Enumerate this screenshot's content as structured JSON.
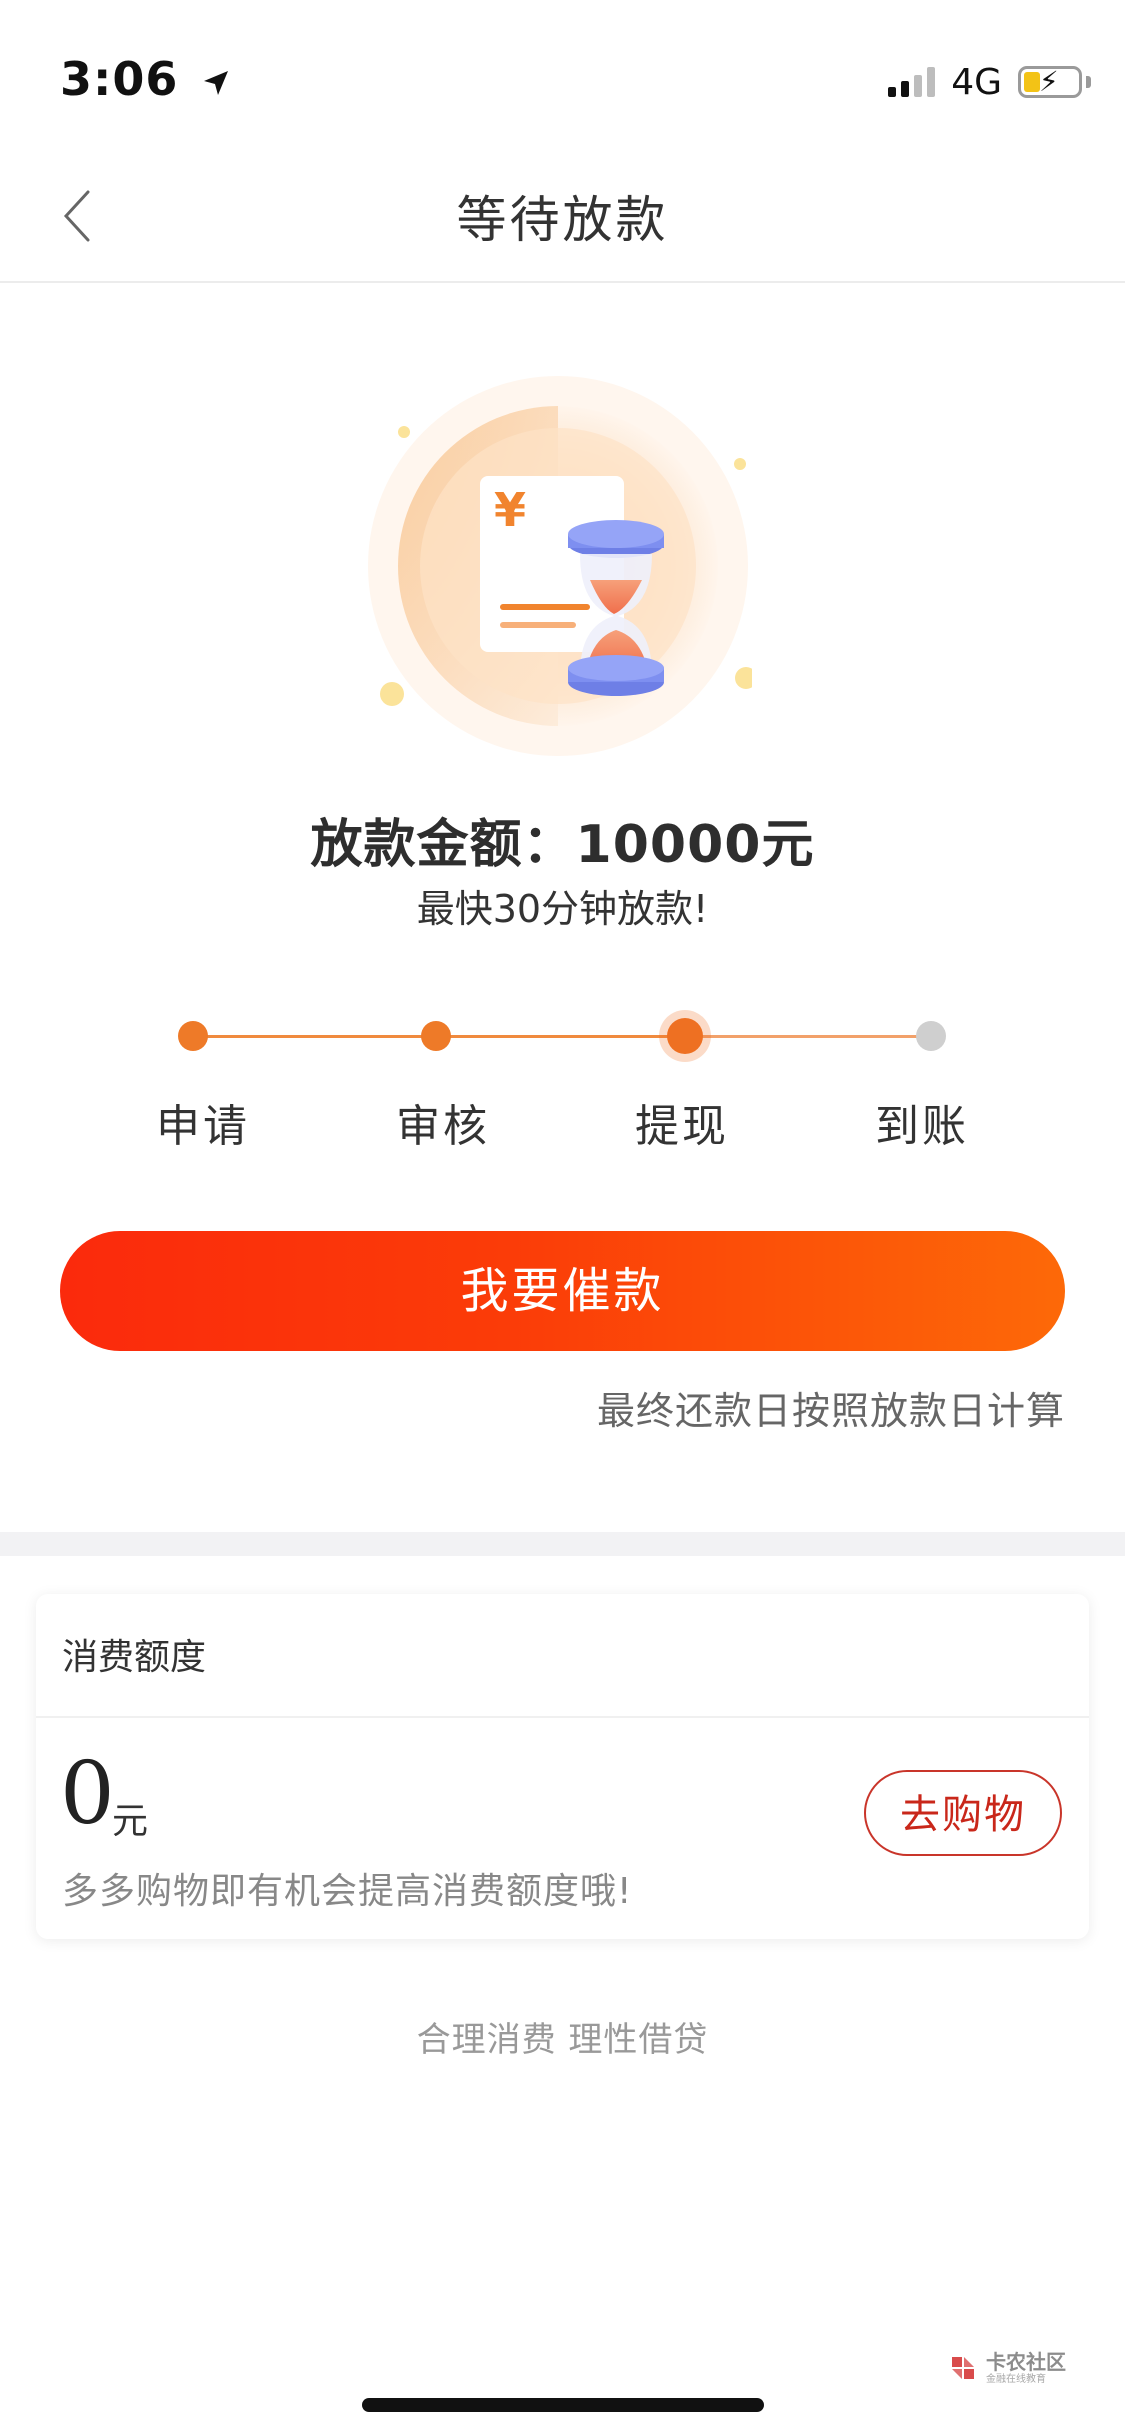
{
  "status_bar": {
    "time": "3:06",
    "network": "4G"
  },
  "nav": {
    "title": "等待放款"
  },
  "loan": {
    "amount_text": "放款金额：10000元",
    "speed_text": "最快30分钟放款!"
  },
  "progress": {
    "current_step_index": 2,
    "steps": [
      {
        "label": "申请",
        "state": "done"
      },
      {
        "label": "审核",
        "state": "done"
      },
      {
        "label": "提现",
        "state": "current"
      },
      {
        "label": "到账",
        "state": "pending"
      }
    ]
  },
  "actions": {
    "urge_label": "我要催款"
  },
  "repay_note": "最终还款日按照放款日计算",
  "consumption": {
    "title": "消费额度",
    "value": "0",
    "unit": "元",
    "hint": "多多购物即有机会提高消费额度哦!",
    "shop_label": "去购物"
  },
  "footer": {
    "slogan": "合理消费 理性借贷"
  },
  "watermark": {
    "title": "卡农社区",
    "subtitle": "金融在线教育"
  },
  "colors": {
    "accent": "#fb2a0c",
    "accent_end": "#fd6908",
    "step_active": "#ee7a28",
    "step_pending": "#cfcfcf",
    "shop_border": "#c9352a"
  }
}
